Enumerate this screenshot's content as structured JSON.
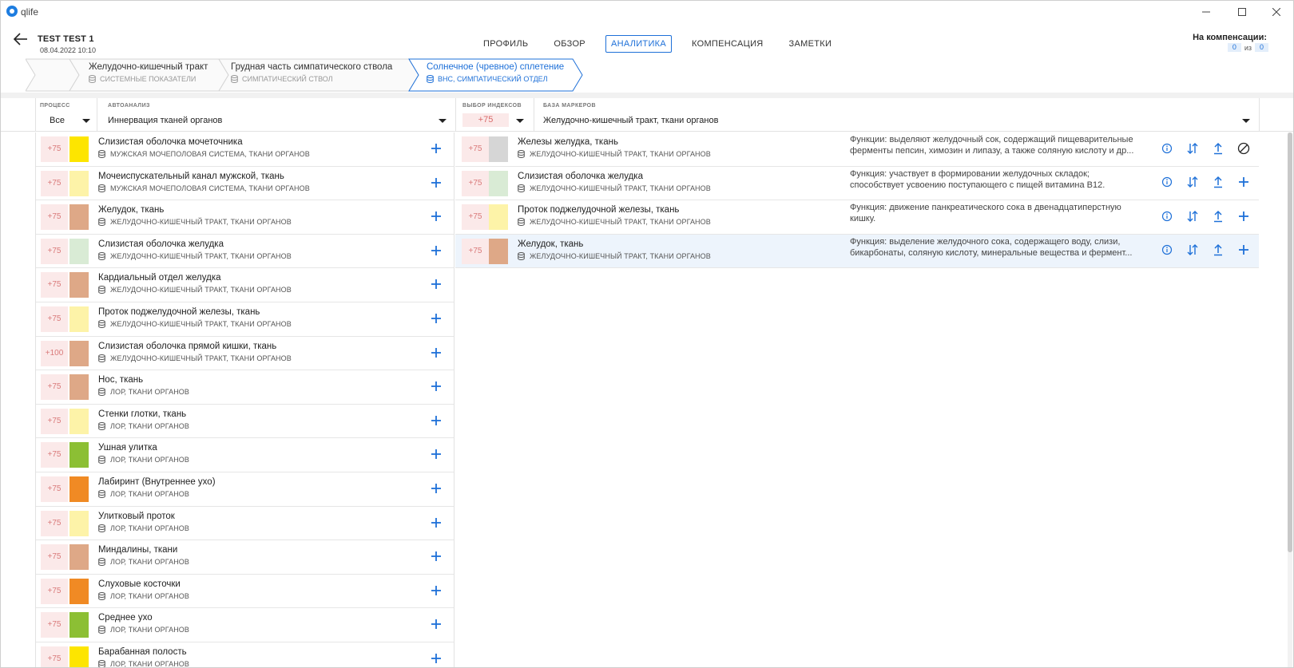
{
  "window": {
    "app_name": "qlife",
    "minimize": "—",
    "maximize": "☐",
    "close": "✕"
  },
  "patient": {
    "name": "TEST TEST 1",
    "date": "08.04.2022 10:10"
  },
  "nav": {
    "tabs": [
      "ПРОФИЛЬ",
      "ОБЗОР",
      "АНАЛИТИКА",
      "КОМПЕНСАЦИЯ",
      "ЗАМЕТКИ"
    ],
    "active": "АНАЛИТИКА"
  },
  "compensation": {
    "label": "На компенсации:",
    "current": "0",
    "of_text": "из",
    "total": "0"
  },
  "breadcrumb": [
    {
      "title": "Желудочно-кишечный тракт",
      "subtitle": "СИСТЕМНЫЕ ПОКАЗАТЕЛИ"
    },
    {
      "title": "Грудная часть симпатического ствола",
      "subtitle": "СИМПАТИЧЕСКИЙ СТВОЛ"
    },
    {
      "title": "Солнечное (чревное) сплетение",
      "subtitle": "ВНС, СИМПАТИЧЕСКИЙ ОТДЕЛ"
    }
  ],
  "filters": {
    "process_label": "ПРОЦЕСС",
    "process_value": "Все",
    "auto_label": "АВТОАНАЛИЗ",
    "auto_value": "Иннервация тканей органов",
    "index_label": "ВЫБОР ИНДЕКСОВ",
    "index_value": "+75",
    "markers_label": "БАЗА МАРКЕРОВ",
    "markers_value": "Желудочно-кишечный тракт, ткани органов"
  },
  "left_rows": [
    {
      "score": "+75",
      "color": "#fde500",
      "title": "Слизистая оболочка мочеточника",
      "subtitle": "МУЖСКАЯ МОЧЕПОЛОВАЯ СИСТЕМА, ТКАНИ ОРГАНОВ"
    },
    {
      "score": "+75",
      "color": "#fdf3a8",
      "title": "Мочеиспускательный канал мужской, ткань",
      "subtitle": "МУЖСКАЯ МОЧЕПОЛОВАЯ СИСТЕМА, ТКАНИ ОРГАНОВ"
    },
    {
      "score": "+75",
      "color": "#dea887",
      "title": "Желудок, ткань",
      "subtitle": "ЖЕЛУДОЧНО-КИШЕЧНЫЙ ТРАКТ, ТКАНИ ОРГАНОВ"
    },
    {
      "score": "+75",
      "color": "#d9ebd5",
      "title": "Слизистая оболочка желудка",
      "subtitle": "ЖЕЛУДОЧНО-КИШЕЧНЫЙ ТРАКТ, ТКАНИ ОРГАНОВ"
    },
    {
      "score": "+75",
      "color": "#dea887",
      "title": "Кардиальный отдел желудка",
      "subtitle": "ЖЕЛУДОЧНО-КИШЕЧНЫЙ ТРАКТ, ТКАНИ ОРГАНОВ"
    },
    {
      "score": "+75",
      "color": "#fdf3a8",
      "title": "Проток поджелудочной железы, ткань",
      "subtitle": "ЖЕЛУДОЧНО-КИШЕЧНЫЙ ТРАКТ, ТКАНИ ОРГАНОВ"
    },
    {
      "score": "+100",
      "color": "#dea887",
      "title": "Слизистая оболочка прямой кишки, ткань",
      "subtitle": "ЖЕЛУДОЧНО-КИШЕЧНЫЙ ТРАКТ, ТКАНИ ОРГАНОВ"
    },
    {
      "score": "+75",
      "color": "#dea887",
      "title": "Нос, ткань",
      "subtitle": "ЛОР, ТКАНИ ОРГАНОВ"
    },
    {
      "score": "+75",
      "color": "#fdf3a8",
      "title": "Стенки глотки, ткань",
      "subtitle": "ЛОР, ТКАНИ ОРГАНОВ"
    },
    {
      "score": "+75",
      "color": "#8cbf34",
      "title": "Ушная улитка",
      "subtitle": "ЛОР, ТКАНИ ОРГАНОВ"
    },
    {
      "score": "+75",
      "color": "#f08a24",
      "title": "Лабиринт (Внутреннее ухо)",
      "subtitle": "ЛОР, ТКАНИ ОРГАНОВ"
    },
    {
      "score": "+75",
      "color": "#fdf3a8",
      "title": "Улитковый проток",
      "subtitle": "ЛОР, ТКАНИ ОРГАНОВ"
    },
    {
      "score": "+75",
      "color": "#dea887",
      "title": "Миндалины, ткани",
      "subtitle": "ЛОР, ТКАНИ ОРГАНОВ"
    },
    {
      "score": "+75",
      "color": "#f08a24",
      "title": "Слуховые косточки",
      "subtitle": "ЛОР, ТКАНИ ОРГАНОВ"
    },
    {
      "score": "+75",
      "color": "#8cbf34",
      "title": "Среднее ухо",
      "subtitle": "ЛОР, ТКАНИ ОРГАНОВ"
    },
    {
      "score": "+75",
      "color": "#fde500",
      "title": "Барабанная полость",
      "subtitle": "ЛОР, ТКАНИ ОРГАНОВ"
    }
  ],
  "right_rows": [
    {
      "score": "+75",
      "color": "#d6d6d6",
      "title": "Железы желудка, ткань",
      "subtitle": "ЖЕЛУДОЧНО-КИШЕЧНЫЙ ТРАКТ, ТКАНИ ОРГАНОВ",
      "desc": "Функции: выделяют желудочный сок, содержащий пищеварительные ферменты пепсин, химозин и липазу, а также соляную кислоту и др...",
      "last_action": "block-icon",
      "selected": false
    },
    {
      "score": "+75",
      "color": "#d9ebd5",
      "title": "Слизистая оболочка желудка",
      "subtitle": "ЖЕЛУДОЧНО-КИШЕЧНЫЙ ТРАКТ, ТКАНИ ОРГАНОВ",
      "desc": "Функция: участвует в формировании желудочных складок; способствует усвоению поступающего с пищей витамина B12.",
      "last_action": "plus-icon",
      "selected": false
    },
    {
      "score": "+75",
      "color": "#fdf3a8",
      "title": "Проток поджелудочной железы, ткань",
      "subtitle": "ЖЕЛУДОЧНО-КИШЕЧНЫЙ ТРАКТ, ТКАНИ ОРГАНОВ",
      "desc": "Функция: движение панкреатического сока в двенадцатиперстную кишку.",
      "last_action": "plus-icon",
      "selected": false
    },
    {
      "score": "+75",
      "color": "#dea887",
      "title": "Желудок, ткань",
      "subtitle": "ЖЕЛУДОЧНО-КИШЕЧНЫЙ ТРАКТ, ТКАНИ ОРГАНОВ",
      "desc": "Функция: выделение желудочного сока, содержащего воду, слизи, бикарбонаты, соляную кислоту, минеральные вещества и фермент...",
      "last_action": "plus-icon",
      "selected": true
    }
  ],
  "colors": {
    "accent": "#1e70d8",
    "score_bg": "#fbe9e9",
    "score_text": "#d97a7a",
    "selected_row": "#edf4fc"
  }
}
